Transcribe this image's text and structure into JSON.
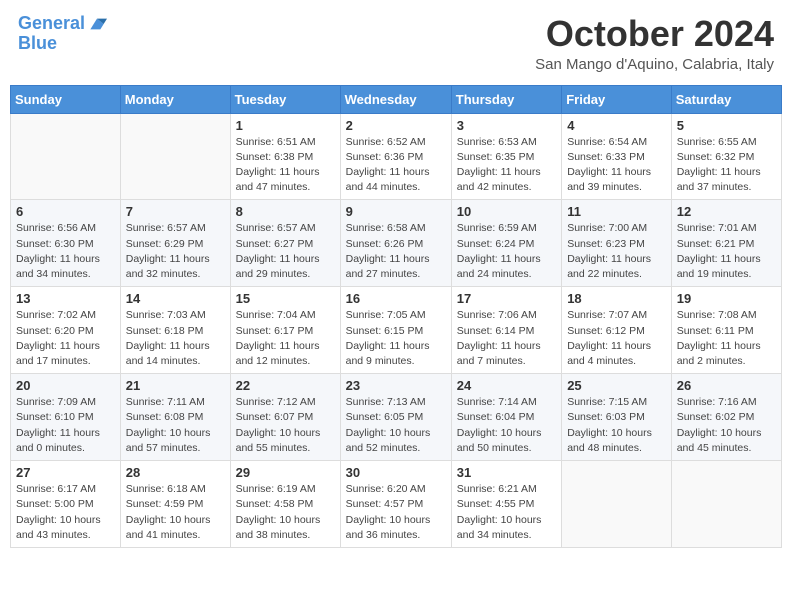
{
  "header": {
    "logo_line1": "General",
    "logo_line2": "Blue",
    "month": "October 2024",
    "location": "San Mango d'Aquino, Calabria, Italy"
  },
  "weekdays": [
    "Sunday",
    "Monday",
    "Tuesday",
    "Wednesday",
    "Thursday",
    "Friday",
    "Saturday"
  ],
  "weeks": [
    [
      {
        "day": "",
        "info": ""
      },
      {
        "day": "",
        "info": ""
      },
      {
        "day": "1",
        "info": "Sunrise: 6:51 AM\nSunset: 6:38 PM\nDaylight: 11 hours and 47 minutes."
      },
      {
        "day": "2",
        "info": "Sunrise: 6:52 AM\nSunset: 6:36 PM\nDaylight: 11 hours and 44 minutes."
      },
      {
        "day": "3",
        "info": "Sunrise: 6:53 AM\nSunset: 6:35 PM\nDaylight: 11 hours and 42 minutes."
      },
      {
        "day": "4",
        "info": "Sunrise: 6:54 AM\nSunset: 6:33 PM\nDaylight: 11 hours and 39 minutes."
      },
      {
        "day": "5",
        "info": "Sunrise: 6:55 AM\nSunset: 6:32 PM\nDaylight: 11 hours and 37 minutes."
      }
    ],
    [
      {
        "day": "6",
        "info": "Sunrise: 6:56 AM\nSunset: 6:30 PM\nDaylight: 11 hours and 34 minutes."
      },
      {
        "day": "7",
        "info": "Sunrise: 6:57 AM\nSunset: 6:29 PM\nDaylight: 11 hours and 32 minutes."
      },
      {
        "day": "8",
        "info": "Sunrise: 6:57 AM\nSunset: 6:27 PM\nDaylight: 11 hours and 29 minutes."
      },
      {
        "day": "9",
        "info": "Sunrise: 6:58 AM\nSunset: 6:26 PM\nDaylight: 11 hours and 27 minutes."
      },
      {
        "day": "10",
        "info": "Sunrise: 6:59 AM\nSunset: 6:24 PM\nDaylight: 11 hours and 24 minutes."
      },
      {
        "day": "11",
        "info": "Sunrise: 7:00 AM\nSunset: 6:23 PM\nDaylight: 11 hours and 22 minutes."
      },
      {
        "day": "12",
        "info": "Sunrise: 7:01 AM\nSunset: 6:21 PM\nDaylight: 11 hours and 19 minutes."
      }
    ],
    [
      {
        "day": "13",
        "info": "Sunrise: 7:02 AM\nSunset: 6:20 PM\nDaylight: 11 hours and 17 minutes."
      },
      {
        "day": "14",
        "info": "Sunrise: 7:03 AM\nSunset: 6:18 PM\nDaylight: 11 hours and 14 minutes."
      },
      {
        "day": "15",
        "info": "Sunrise: 7:04 AM\nSunset: 6:17 PM\nDaylight: 11 hours and 12 minutes."
      },
      {
        "day": "16",
        "info": "Sunrise: 7:05 AM\nSunset: 6:15 PM\nDaylight: 11 hours and 9 minutes."
      },
      {
        "day": "17",
        "info": "Sunrise: 7:06 AM\nSunset: 6:14 PM\nDaylight: 11 hours and 7 minutes."
      },
      {
        "day": "18",
        "info": "Sunrise: 7:07 AM\nSunset: 6:12 PM\nDaylight: 11 hours and 4 minutes."
      },
      {
        "day": "19",
        "info": "Sunrise: 7:08 AM\nSunset: 6:11 PM\nDaylight: 11 hours and 2 minutes."
      }
    ],
    [
      {
        "day": "20",
        "info": "Sunrise: 7:09 AM\nSunset: 6:10 PM\nDaylight: 11 hours and 0 minutes."
      },
      {
        "day": "21",
        "info": "Sunrise: 7:11 AM\nSunset: 6:08 PM\nDaylight: 10 hours and 57 minutes."
      },
      {
        "day": "22",
        "info": "Sunrise: 7:12 AM\nSunset: 6:07 PM\nDaylight: 10 hours and 55 minutes."
      },
      {
        "day": "23",
        "info": "Sunrise: 7:13 AM\nSunset: 6:05 PM\nDaylight: 10 hours and 52 minutes."
      },
      {
        "day": "24",
        "info": "Sunrise: 7:14 AM\nSunset: 6:04 PM\nDaylight: 10 hours and 50 minutes."
      },
      {
        "day": "25",
        "info": "Sunrise: 7:15 AM\nSunset: 6:03 PM\nDaylight: 10 hours and 48 minutes."
      },
      {
        "day": "26",
        "info": "Sunrise: 7:16 AM\nSunset: 6:02 PM\nDaylight: 10 hours and 45 minutes."
      }
    ],
    [
      {
        "day": "27",
        "info": "Sunrise: 6:17 AM\nSunset: 5:00 PM\nDaylight: 10 hours and 43 minutes."
      },
      {
        "day": "28",
        "info": "Sunrise: 6:18 AM\nSunset: 4:59 PM\nDaylight: 10 hours and 41 minutes."
      },
      {
        "day": "29",
        "info": "Sunrise: 6:19 AM\nSunset: 4:58 PM\nDaylight: 10 hours and 38 minutes."
      },
      {
        "day": "30",
        "info": "Sunrise: 6:20 AM\nSunset: 4:57 PM\nDaylight: 10 hours and 36 minutes."
      },
      {
        "day": "31",
        "info": "Sunrise: 6:21 AM\nSunset: 4:55 PM\nDaylight: 10 hours and 34 minutes."
      },
      {
        "day": "",
        "info": ""
      },
      {
        "day": "",
        "info": ""
      }
    ]
  ]
}
